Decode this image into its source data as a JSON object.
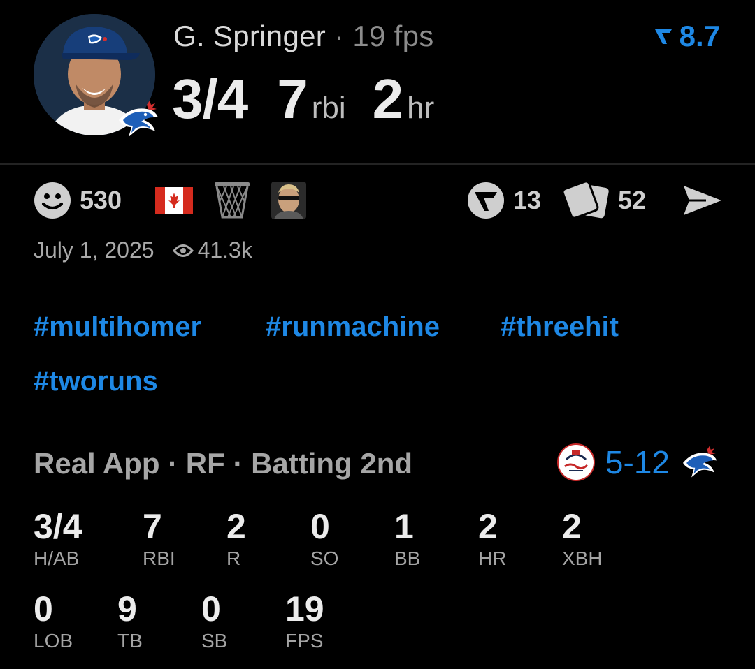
{
  "header": {
    "player_name": "G. Springer",
    "separator": "·",
    "fantasy_points": "19 fps",
    "rating": "8.7",
    "hits_ab": "3/4",
    "rbi_value": "7",
    "rbi_unit": "rbi",
    "hr_value": "2",
    "hr_unit": "hr"
  },
  "actions": {
    "reactions_count": "530",
    "flag_icon": "canada-flag-icon",
    "net_icon": "basketball-net-icon",
    "avatar_icon": "user-avatar-icon",
    "comments_count": "13",
    "cards_count": "52",
    "share_icon": "share-send-icon"
  },
  "meta": {
    "date": "July 1, 2025",
    "views": "41.3k"
  },
  "hashtags": [
    "#multihomer",
    "#runmachine",
    "#threehit",
    "#tworuns"
  ],
  "game": {
    "description": "Real App · RF · Batting 2nd",
    "score": "5-12",
    "opponent_logo": "yankees-logo",
    "team_logo": "blue-jays-logo"
  },
  "stats": [
    {
      "value": "3/4",
      "label": "H/AB"
    },
    {
      "value": "7",
      "label": "RBI"
    },
    {
      "value": "2",
      "label": "R"
    },
    {
      "value": "0",
      "label": "SO"
    },
    {
      "value": "1",
      "label": "BB"
    },
    {
      "value": "2",
      "label": "HR"
    },
    {
      "value": "2",
      "label": "XBH"
    },
    {
      "value": "0",
      "label": "LOB"
    },
    {
      "value": "9",
      "label": "TB"
    },
    {
      "value": "0",
      "label": "SB"
    },
    {
      "value": "19",
      "label": "FPS"
    }
  ],
  "colors": {
    "background": "#000000",
    "accent": "#1e88e5",
    "primary_text": "#ebebeb",
    "secondary_text": "#a6a6a6"
  }
}
